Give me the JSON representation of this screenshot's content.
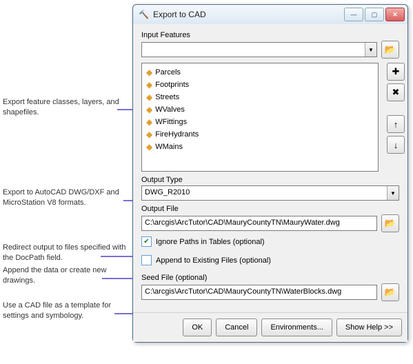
{
  "window": {
    "title": "Export to CAD",
    "min_icon": "—",
    "max_icon": "▢",
    "close_icon": "✕",
    "hammer_icon": "🔨"
  },
  "labels": {
    "input_features": "Input Features",
    "output_type": "Output Type",
    "output_file": "Output File",
    "ignore_paths": "Ignore Paths in Tables (optional)",
    "append_existing": "Append to Existing Files (optional)",
    "seed_file": "Seed File (optional)"
  },
  "input_combo": {
    "value": ""
  },
  "feature_items": [
    {
      "label": "Parcels"
    },
    {
      "label": "Footprints"
    },
    {
      "label": "Streets"
    },
    {
      "label": "WValves"
    },
    {
      "label": "WFittings"
    },
    {
      "label": "FireHydrants"
    },
    {
      "label": "WMains"
    }
  ],
  "side_buttons": {
    "add": "✚",
    "remove": "✖",
    "up": "↑",
    "down": "↓"
  },
  "output_type": {
    "value": "DWG_R2010"
  },
  "output_file": {
    "value": "C:\\arcgis\\ArcTutor\\CAD\\MauryCountyTN\\MauryWater.dwg"
  },
  "ignore_paths_checked": "✔",
  "append_existing_checked": "",
  "seed_file": {
    "value": "C:\\arcgis\\ArcTutor\\CAD\\MauryCountyTN\\WaterBlocks.dwg"
  },
  "buttons": {
    "ok": "OK",
    "cancel": "Cancel",
    "env": "Environments...",
    "help": "Show Help >>"
  },
  "annotations": {
    "a1": "Export feature classes, layers, and shapefiles.",
    "a2": "Export to AutoCAD DWG/DXF and MicroStation V8 formats.",
    "a3": "Redirect output to files specified with the DocPath field.",
    "a4": "Append the data or create new drawings.",
    "a5": "Use a CAD file as a template for settings and symbology."
  },
  "icons": {
    "browse": "📂",
    "dropdown": "▼"
  }
}
